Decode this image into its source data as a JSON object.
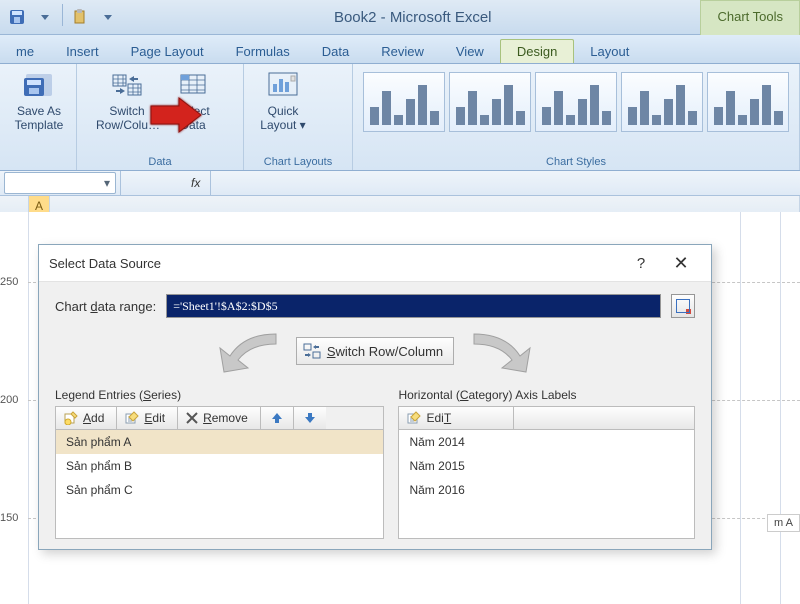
{
  "app": {
    "title": "Book2 - Microsoft Excel",
    "tools_tab": "Chart Tools"
  },
  "tabs": {
    "home": "me",
    "insert": "Insert",
    "page_layout": "Page Layout",
    "formulas": "Formulas",
    "data": "Data",
    "review": "Review",
    "view": "View",
    "design": "Design",
    "layout": "Layout"
  },
  "groups": {
    "templates": {
      "save_as": "Save As Template",
      "title": ""
    },
    "data": {
      "switch": "Switch Row/Colu…",
      "select": "Select Data",
      "title": "Data"
    },
    "layouts": {
      "quick": "Quick Layout ▾",
      "title": "Chart Layouts"
    },
    "styles": {
      "title": "Chart Styles"
    }
  },
  "fx": {
    "label": "fx"
  },
  "col": {
    "a": "A"
  },
  "axis": {
    "v250": "250",
    "v200": "200",
    "v150": "150"
  },
  "dialog": {
    "title": "Select Data Source",
    "range_label_pre": "Chart ",
    "range_label_u": "d",
    "range_label_post": "ata range:",
    "range_value": "='Sheet1'!$A$2:$D$5",
    "switch": "Switch Row/Column",
    "series": {
      "title_pre": "Legend Entries (",
      "title_u": "S",
      "title_post": "eries)",
      "add_u": "A",
      "add": "dd",
      "edit_u": "E",
      "edit": "dit",
      "remove_u": "R",
      "remove": "emove",
      "items": [
        "Sản phẩm A",
        "Sản phẩm B",
        "Sản phẩm C"
      ]
    },
    "cats": {
      "title_pre": "Horizontal (",
      "title_u": "C",
      "title_post": "ategory) Axis Labels",
      "edit_u": "T",
      "edit": "Edi",
      "items": [
        "Năm 2014",
        "Năm 2015",
        "Năm 2016"
      ]
    }
  },
  "clip": "m A",
  "help": "?"
}
